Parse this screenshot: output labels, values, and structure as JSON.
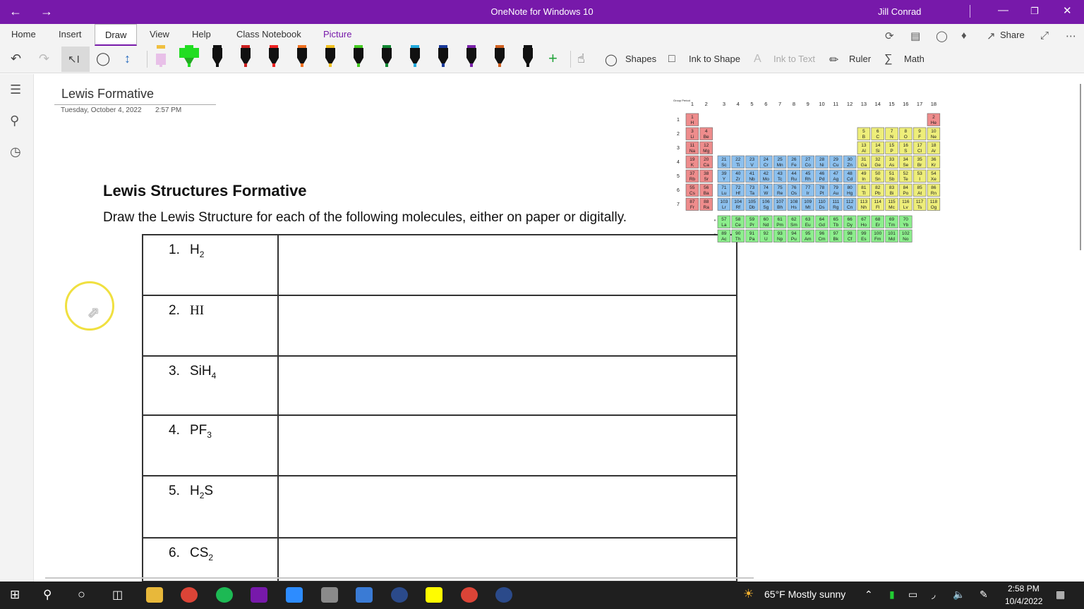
{
  "window": {
    "title": "OneNote for Windows 10",
    "user": "Jill Conrad"
  },
  "ribbon": {
    "tabs": [
      "Home",
      "Insert",
      "Draw",
      "View",
      "Help",
      "Class Notebook",
      "Picture"
    ],
    "active_tab": "Draw",
    "share_label": "Share"
  },
  "toolbar": {
    "pen_colors": [
      "#e8c0e8",
      "#22dd22",
      "#111111",
      "#cc2020",
      "#ee2222",
      "#f07020",
      "#f0c020",
      "#44cc22",
      "#118833",
      "#22aadd",
      "#1a3a9a",
      "#7a22aa",
      "#d06020",
      "#111111"
    ],
    "shapes_label": "Shapes",
    "ink_to_shape_label": "Ink to Shape",
    "ink_to_text_label": "Ink to Text",
    "ruler_label": "Ruler",
    "math_label": "Math",
    "accent_color": "#7719aa"
  },
  "page": {
    "title": "Lewis Formative",
    "date": "Tuesday, October 4, 2022",
    "time": "2:57 PM",
    "heading": "Lewis Structures Formative",
    "instructions": "Draw the Lewis Structure for each of the following molecules, either on paper or digitally."
  },
  "questions": [
    {
      "num": "1.",
      "base": "H",
      "sub": "2",
      "tail": ""
    },
    {
      "num": "2.",
      "base": "HI",
      "sub": "",
      "tail": ""
    },
    {
      "num": "3.",
      "base": "SiH",
      "sub": "4",
      "tail": ""
    },
    {
      "num": "4.",
      "base": "PF",
      "sub": "3",
      "tail": ""
    },
    {
      "num": "5.",
      "base": "H",
      "sub": "2",
      "tail": "S"
    },
    {
      "num": "6.",
      "base": "CS",
      "sub": "2",
      "tail": ""
    }
  ],
  "periodic_table": {
    "header_label": "Group Period",
    "groups": [
      "1",
      "2",
      "3",
      "4",
      "5",
      "6",
      "7",
      "8",
      "9",
      "10",
      "11",
      "12",
      "13",
      "14",
      "15",
      "16",
      "17",
      "18"
    ],
    "periods": [
      "1",
      "2",
      "3",
      "4",
      "5",
      "6",
      "7"
    ],
    "symbols": {
      "1": [
        "H",
        "",
        "",
        "",
        "",
        "",
        "",
        "",
        "",
        "",
        "",
        "",
        "",
        "",
        "",
        "",
        "",
        "He"
      ],
      "2": [
        "Li",
        "Be",
        "",
        "",
        "",
        "",
        "",
        "",
        "",
        "",
        "",
        "",
        "B",
        "C",
        "N",
        "O",
        "F",
        "Ne"
      ],
      "3": [
        "Na",
        "Mg",
        "",
        "",
        "",
        "",
        "",
        "",
        "",
        "",
        "",
        "",
        "Al",
        "Si",
        "P",
        "S",
        "Cl",
        "Ar"
      ],
      "4": [
        "K",
        "Ca",
        "Sc",
        "Ti",
        "V",
        "Cr",
        "Mn",
        "Fe",
        "Co",
        "Ni",
        "Cu",
        "Zn",
        "Ga",
        "Ge",
        "As",
        "Se",
        "Br",
        "Kr"
      ],
      "5": [
        "Rb",
        "Sr",
        "Y",
        "Zr",
        "Nb",
        "Mo",
        "Tc",
        "Ru",
        "Rh",
        "Pd",
        "Ag",
        "Cd",
        "In",
        "Sn",
        "Sb",
        "Te",
        "I",
        "Xe"
      ],
      "6": [
        "Cs",
        "Ba",
        "Lu",
        "Hf",
        "Ta",
        "W",
        "Re",
        "Os",
        "Ir",
        "Pt",
        "Au",
        "Hg",
        "Tl",
        "Pb",
        "Bi",
        "Po",
        "At",
        "Rn"
      ],
      "7": [
        "Fr",
        "Ra",
        "Lr",
        "Rf",
        "Db",
        "Sg",
        "Bh",
        "Hs",
        "Mt",
        "Ds",
        "Rg",
        "Cn",
        "Nh",
        "Fl",
        "Mc",
        "Lv",
        "Ts",
        "Og"
      ]
    },
    "numbers": {
      "1": [
        "1",
        "",
        "",
        "",
        "",
        "",
        "",
        "",
        "",
        "",
        "",
        "",
        "",
        "",
        "",
        "",
        "",
        "2"
      ],
      "2": [
        "3",
        "4",
        "",
        "",
        "",
        "",
        "",
        "",
        "",
        "",
        "",
        "",
        "5",
        "6",
        "7",
        "8",
        "9",
        "10"
      ],
      "3": [
        "11",
        "12",
        "",
        "",
        "",
        "",
        "",
        "",
        "",
        "",
        "",
        "",
        "13",
        "14",
        "15",
        "16",
        "17",
        "18"
      ],
      "4": [
        "19",
        "20",
        "21",
        "22",
        "23",
        "24",
        "25",
        "26",
        "27",
        "28",
        "29",
        "30",
        "31",
        "32",
        "33",
        "34",
        "35",
        "36"
      ],
      "5": [
        "37",
        "38",
        "39",
        "40",
        "41",
        "42",
        "43",
        "44",
        "45",
        "46",
        "47",
        "48",
        "49",
        "50",
        "51",
        "52",
        "53",
        "54"
      ],
      "6": [
        "55",
        "56",
        "71",
        "72",
        "73",
        "74",
        "75",
        "76",
        "77",
        "78",
        "79",
        "80",
        "81",
        "82",
        "83",
        "84",
        "85",
        "86"
      ],
      "7": [
        "87",
        "88",
        "103",
        "104",
        "105",
        "106",
        "107",
        "108",
        "109",
        "110",
        "111",
        "112",
        "113",
        "114",
        "115",
        "116",
        "117",
        "118"
      ]
    },
    "lanthanides": {
      "symbols": [
        "La",
        "Ce",
        "Pr",
        "Nd",
        "Pm",
        "Sm",
        "Eu",
        "Gd",
        "Tb",
        "Dy",
        "Ho",
        "Er",
        "Tm",
        "Yb"
      ],
      "numbers": [
        "57",
        "58",
        "59",
        "60",
        "61",
        "62",
        "63",
        "64",
        "65",
        "66",
        "67",
        "68",
        "69",
        "70"
      ]
    },
    "actinides": {
      "symbols": [
        "Ac",
        "Th",
        "Pa",
        "U",
        "Np",
        "Pu",
        "Am",
        "Cm",
        "Bk",
        "Cf",
        "Es",
        "Fm",
        "Md",
        "No"
      ],
      "numbers": [
        "89",
        "90",
        "91",
        "92",
        "93",
        "94",
        "95",
        "96",
        "97",
        "98",
        "99",
        "100",
        "101",
        "102"
      ]
    },
    "colors": {
      "s": "#ee8c8c",
      "d": "#8cc0ee",
      "p": "#eeee7a",
      "f": "#8cee8c"
    }
  },
  "taskbar": {
    "weather": "65°F  Mostly sunny",
    "time": "2:58 PM",
    "date": "10/4/2022"
  }
}
